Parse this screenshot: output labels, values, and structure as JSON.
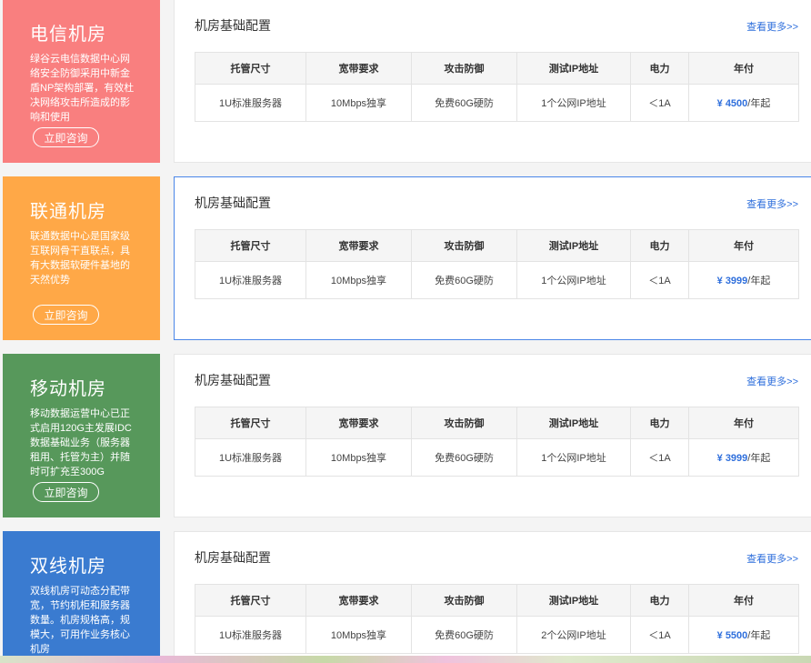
{
  "colors": {
    "accent": "#2f6fdc"
  },
  "headers": [
    "托管尺寸",
    "宽带要求",
    "攻击防御",
    "测试IP地址",
    "电力",
    "年付"
  ],
  "panel_title": "机房基础配置",
  "more_label": "查看更多>>",
  "consult_label": "立即咨询",
  "rooms": [
    {
      "title": "电信机房",
      "color": "#f97f7f",
      "desc": "绿谷云电信数据中心网络安全防御采用中新金盾NP架构部署，有效杜决网络攻击所造成的影响和使用",
      "row": [
        "1U标准服务器",
        "10Mbps独享",
        "免费60G硬防",
        "1个公网IP地址",
        "＜1A"
      ],
      "price": "¥ 4500",
      "price_unit": "/年起"
    },
    {
      "title": "联通机房",
      "color": "#ffa847",
      "desc": "联通数据中心是国家级互联网骨干直联点，具有大数据软硬件基地的天然优势",
      "row": [
        "1U标准服务器",
        "10Mbps独享",
        "免费60G硬防",
        "1个公网IP地址",
        "＜1A"
      ],
      "price": "¥ 3999",
      "price_unit": "/年起"
    },
    {
      "title": "移动机房",
      "color": "#57985b",
      "desc": "移动数据运营中心已正式启用120G主发展IDC数据基础业务（服务器租用、托管为主）并随时可扩充至300G",
      "row": [
        "1U标准服务器",
        "10Mbps独享",
        "免费60G硬防",
        "1个公网IP地址",
        "＜1A"
      ],
      "price": "¥ 3999",
      "price_unit": "/年起"
    },
    {
      "title": "双线机房",
      "color": "#3a7bd0",
      "desc": "双线机房可动态分配带宽，节约机柜和服务器数量。机房规格高，规模大，可用作业务核心机房",
      "row": [
        "1U标准服务器",
        "10Mbps独享",
        "免费60G硬防",
        "2个公网IP地址",
        "＜1A"
      ],
      "price": "¥ 5500",
      "price_unit": "/年起"
    }
  ]
}
